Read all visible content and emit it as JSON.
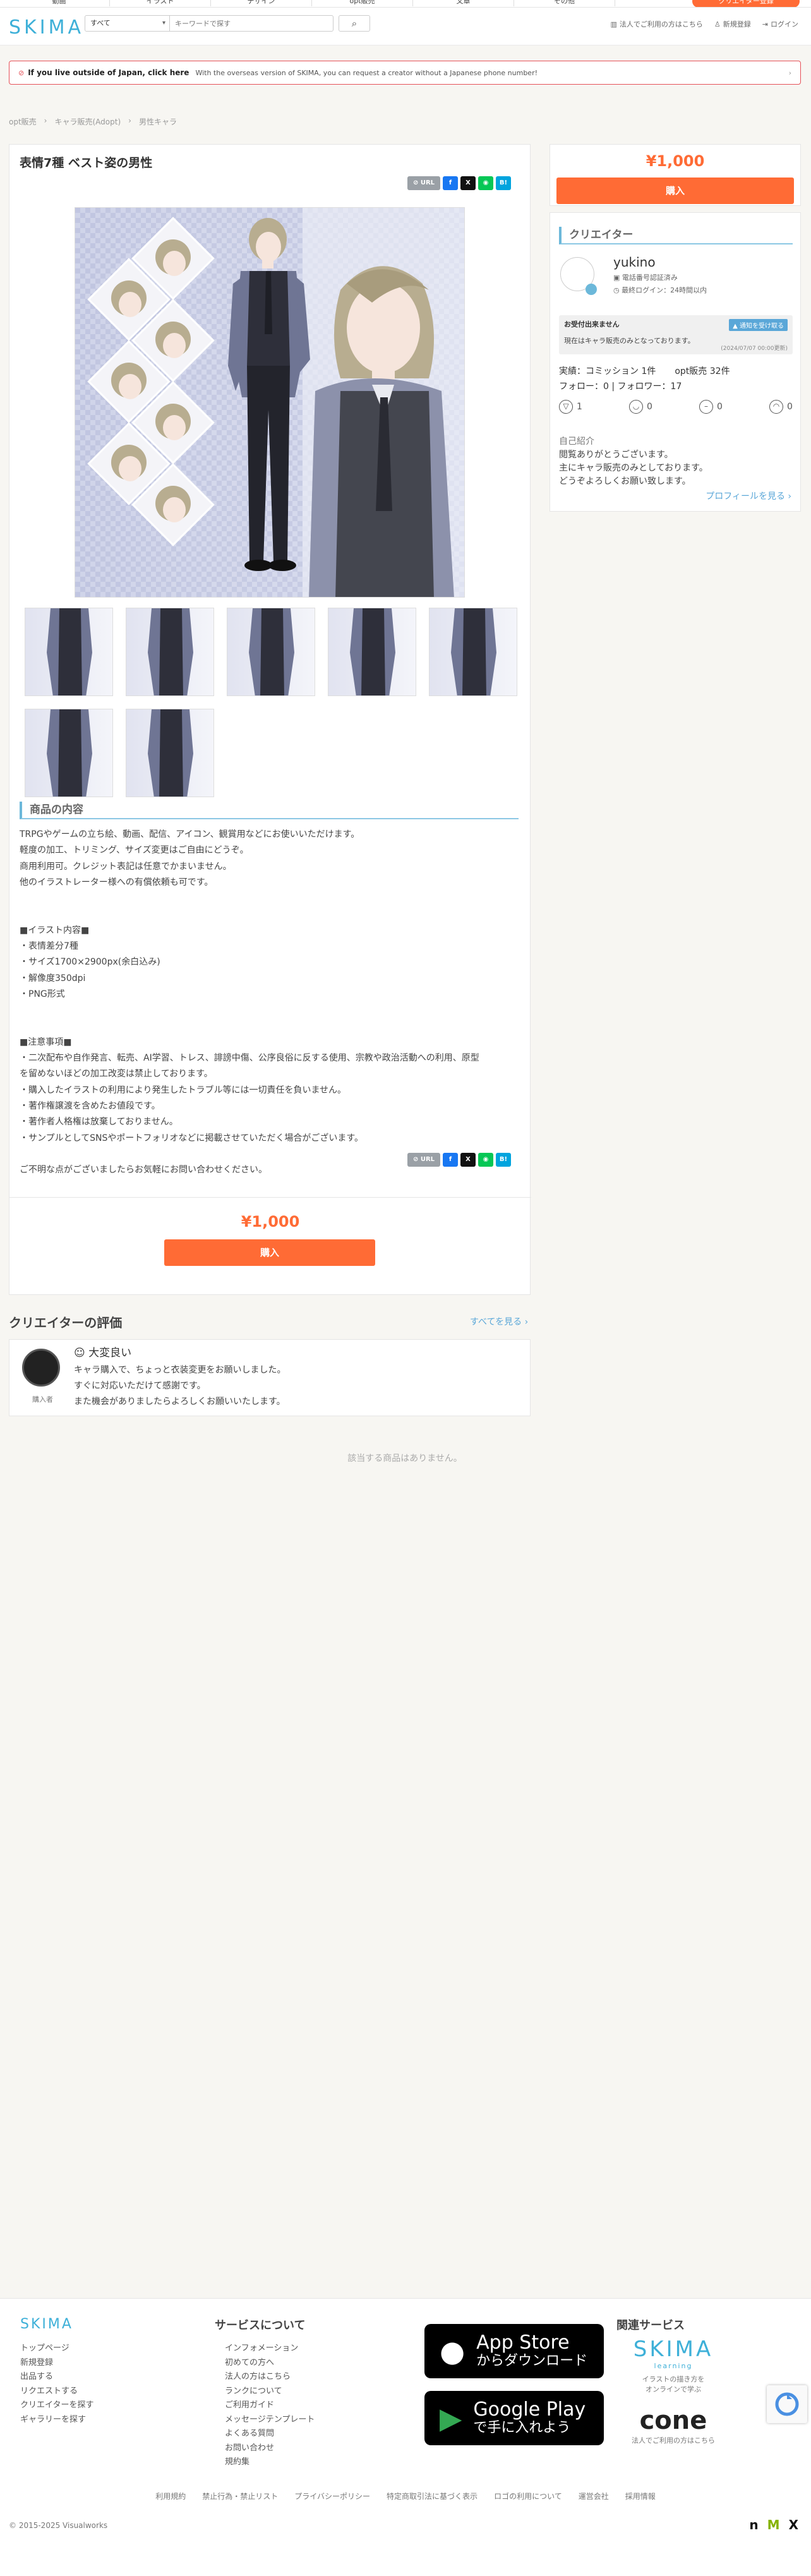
{
  "topnav": {
    "categories": [
      "動画",
      "イラスト",
      "デザイン",
      "opt販売",
      "文章",
      "その他"
    ],
    "cta": "クリエイター登録"
  },
  "header": {
    "logo_main": "SKIMA",
    "search_category": "すべて",
    "search_placeholder": "キーワードで探す",
    "links": {
      "corporate": "法人でご利用の方はこちら",
      "register": "新規登録",
      "login": "ログイン"
    }
  },
  "banner": {
    "title": "If you live outside of Japan, click here",
    "text": "With the overseas version of SKIMA, you can request a creator without a Japanese phone number!"
  },
  "breadcrumb": [
    "opt販売",
    "キャラ販売(Adopt)",
    "男性キャラ"
  ],
  "product": {
    "title": "表情7種 ベスト姿の男性",
    "share_url": "URL",
    "share_hatena": "B!",
    "section_title": "商品の内容",
    "description": [
      "TRPGやゲームの立ち絵、動画、配信、アイコン、観賞用などにお使いいただけます。",
      "軽度の加工、トリミング、サイズ変更はご自由にどうぞ。",
      "商用利用可。クレジット表記は任意でかまいません。",
      "他のイラストレーター様への有償依頼も可です。",
      "",
      "",
      "■イラスト内容■",
      "・表情差分7種",
      "・サイズ1700×2900px(余白込み)",
      "・解像度350dpi",
      "・PNG形式",
      "",
      "",
      "■注意事項■",
      "・二次配布や自作発言、転売、AI学習、トレス、誹謗中傷、公序良俗に反する使用、宗教や政治活動への利用、原型",
      "を留めないほどの加工改変は禁止しております。",
      "・購入したイラストの利用により発生したトラブル等には一切責任を負いません。",
      "・著作権譲渡を含めたお値段です。",
      "・著作者人格権は放棄しておりません。",
      "・サンプルとしてSNSやポートフォリオなどに掲載させていただく場合がございます。",
      "",
      "ご不明な点がございましたらお気軽にお問い合わせください。"
    ],
    "price": "¥1,000",
    "buy_label": "購入"
  },
  "creator": {
    "section_title": "クリエイター",
    "name": "yukino",
    "verified": "電話番号認証済み",
    "last_login": "最終ログイン：24時間以内",
    "notice_title": "お受付出来ません",
    "notice_button": "通知を受け取る",
    "notice_message": "現在はキャラ販売のみとなっております。",
    "notice_date": "(2024/07/07 00:00更新)",
    "stats_commission": "実績：コミッション 1件",
    "stats_opt": "opt販売 32件",
    "follow": "フォロー：0",
    "follower": "フォロワー：17",
    "ratings": [
      "1",
      "0",
      "0",
      "0"
    ],
    "bio_label": "自己紹介",
    "bio": [
      "閲覧ありがとうございます。",
      "主にキャラ販売のみとしております。",
      "どうぞよろしくお願い致します。"
    ],
    "profile_link": "プロフィールを見る ›"
  },
  "evaluations": {
    "title": "クリエイターの評価",
    "see_all": "すべてを見る ›",
    "items": [
      {
        "role": "購入者",
        "rating": "大変良い",
        "text": [
          "キャラ購入で、ちょっと衣装変更をお願いしました。",
          "すぐに対応いただけて感謝です。",
          "また機会がありましたらよろしくお願いいたします。"
        ]
      }
    ]
  },
  "empty_goods": "該当する商品はありません。",
  "footer": {
    "logo": "SKIMA",
    "col1": [
      "トップページ",
      "新規登録",
      "出品する",
      "リクエストする",
      "クリエイターを探す",
      "ギャラリーを探す"
    ],
    "service_title": "サービスについて",
    "col2": [
      "インフォメーション",
      "初めての方へ",
      "法人の方はこちら",
      "ランクについて",
      "ご利用ガイド",
      "メッセージテンプレート",
      "よくある質問",
      "お問い合わせ",
      "規約集"
    ],
    "appstore_l1": "App Store",
    "appstore_l2": "からダウンロード",
    "googleplay_l1": "Google Play",
    "googleplay_l2": "で手に入れよう",
    "related_title": "関連サービス",
    "learning_logo": "SKIMA",
    "learning_sub": "learning",
    "learning_text1": "イラストの描き方を",
    "learning_text2": "オンラインで学ぶ",
    "cone_logo": "cone",
    "cone_text": "法人でご利用の方はこちら",
    "links": [
      "利用規約",
      "禁止行為・禁止リスト",
      "プライバシーポリシー",
      "特定商取引法に基づく表示",
      "ロゴの利用について",
      "運営会社",
      "採用情報"
    ],
    "copyright": "© 2015-2025 Visualworks"
  },
  "colors": {
    "accent": "#ff6b35",
    "link": "#5aa7d8",
    "heading_bar": "#6cb8da"
  }
}
